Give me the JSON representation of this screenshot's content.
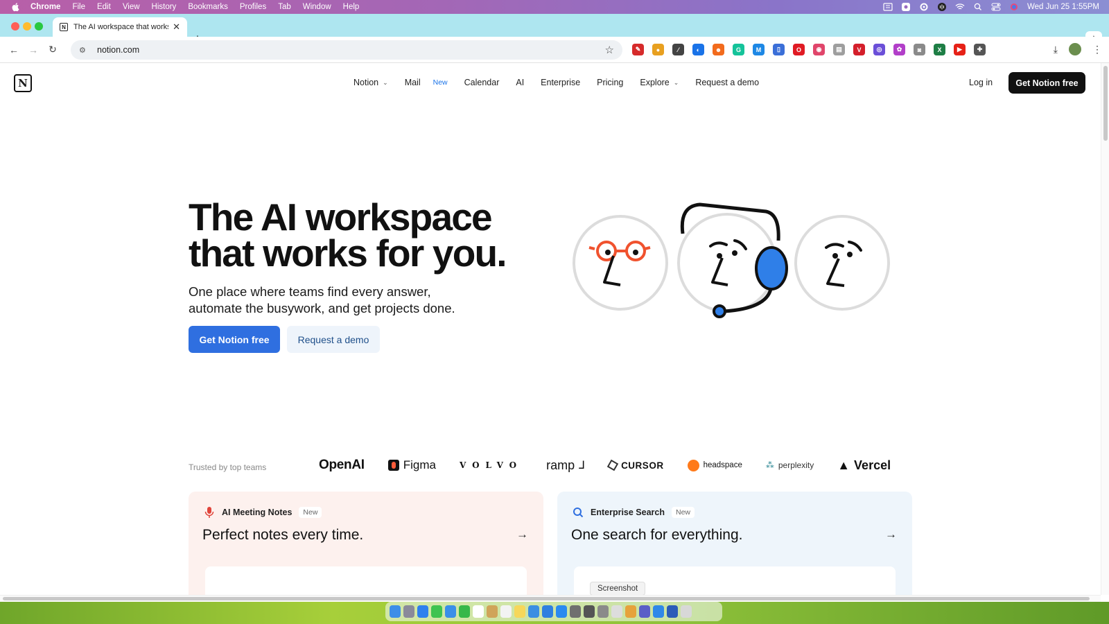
{
  "menubar": {
    "app_name": "Chrome",
    "items": [
      "File",
      "Edit",
      "View",
      "History",
      "Bookmarks",
      "Profiles",
      "Tab",
      "Window",
      "Help"
    ],
    "clock": "Wed Jun 25  1:55PM",
    "status_icons": [
      "mirroring-icon",
      "screen-record-icon",
      "settings-icon",
      "audio-icon",
      "wifi-icon",
      "search-icon",
      "control-center-icon",
      "siri-icon"
    ]
  },
  "browser": {
    "tab_title": "The AI workspace that works",
    "url": "notion.com",
    "extensions": [
      {
        "name": "pen-extension-icon",
        "color": "#d62b2b",
        "glyph": "✎"
      },
      {
        "name": "color-extension-icon",
        "color": "#e8a020",
        "glyph": "●"
      },
      {
        "name": "eyedropper-extension-icon",
        "color": "#444444",
        "glyph": "⁄"
      },
      {
        "name": "blue-extension-icon",
        "color": "#1a73e8",
        "glyph": "◐"
      },
      {
        "name": "orange-extension-icon",
        "color": "#f26b1d",
        "glyph": "☻"
      },
      {
        "name": "grammarly-extension-icon",
        "color": "#15c39a",
        "glyph": "G"
      },
      {
        "name": "m-extension-icon",
        "color": "#1e88e5",
        "glyph": "M"
      },
      {
        "name": "doc-extension-icon",
        "color": "#3b6fd8",
        "glyph": "▯"
      },
      {
        "name": "opera-extension-icon",
        "color": "#e01b24",
        "glyph": "O"
      },
      {
        "name": "pink-extension-icon",
        "color": "#e0466b",
        "glyph": "◉"
      },
      {
        "name": "reader-extension-icon",
        "color": "#9e9e9e",
        "glyph": "▤"
      },
      {
        "name": "vivaldi-extension-icon",
        "color": "#d41f2b",
        "glyph": "V"
      },
      {
        "name": "purple-extension-icon",
        "color": "#6b4fd8",
        "glyph": "◎"
      },
      {
        "name": "flower-extension-icon",
        "color": "#b23fc9",
        "glyph": "✿"
      },
      {
        "name": "camera-extension-icon",
        "color": "#8a8a8a",
        "glyph": "◙"
      },
      {
        "name": "excel-extension-icon",
        "color": "#1e7e45",
        "glyph": "X"
      },
      {
        "name": "youtube-extension-icon",
        "color": "#e62117",
        "glyph": "▶"
      },
      {
        "name": "puzzle-extension-icon",
        "color": "#555555",
        "glyph": "✚"
      }
    ]
  },
  "site": {
    "nav": [
      {
        "label": "Notion",
        "has_chevron": true
      },
      {
        "label": "Mail",
        "badge": "New"
      },
      {
        "label": "Calendar"
      },
      {
        "label": "AI"
      },
      {
        "label": "Enterprise"
      },
      {
        "label": "Pricing"
      },
      {
        "label": "Explore",
        "has_chevron": true
      },
      {
        "label": "Request a demo"
      }
    ],
    "login": "Log in",
    "header_cta": "Get Notion free",
    "hero": {
      "title_line1": "The AI workspace",
      "title_line2": "that works for you.",
      "subtitle_line1": "One place where teams find every answer,",
      "subtitle_line2": "automate the busywork, and get projects done.",
      "primary_cta": "Get Notion free",
      "secondary_cta": "Request a demo"
    },
    "trusted_label": "Trusted by top teams",
    "logos": [
      "OpenAI",
      "Figma",
      "VOLVO",
      "ramp",
      "CURSOR",
      "headspace",
      "perplexity",
      "Vercel"
    ],
    "cards": [
      {
        "tag": "AI Meeting Notes",
        "badge": "New",
        "title": "Perfect notes every time.",
        "accent": "#fdf1ee"
      },
      {
        "tag": "Enterprise Search",
        "badge": "New",
        "title": "One search for everything.",
        "accent": "#eef5fb"
      }
    ],
    "tooltip": "Screenshot"
  },
  "dock": {
    "apps": [
      {
        "name": "finder-icon",
        "color": "#3d8ee8"
      },
      {
        "name": "launchpad-icon",
        "color": "#8a8a9a"
      },
      {
        "name": "safari-icon",
        "color": "#2f80ed"
      },
      {
        "name": "messages-icon",
        "color": "#3fc350"
      },
      {
        "name": "mail-icon",
        "color": "#3a8fe8"
      },
      {
        "name": "facetime-icon",
        "color": "#38b84a"
      },
      {
        "name": "calendar-icon",
        "color": "#ffffff"
      },
      {
        "name": "notes-icon",
        "color": "#d0a45a"
      },
      {
        "name": "reminders-icon",
        "color": "#f3f3f3"
      },
      {
        "name": "stickies-icon",
        "color": "#f6d75a"
      },
      {
        "name": "photos-icon",
        "color": "#3b8ee2"
      },
      {
        "name": "keynote-icon",
        "color": "#2f7fe0"
      },
      {
        "name": "app-store-icon",
        "color": "#2b8af0"
      },
      {
        "name": "settings-icon",
        "color": "#6f6f6f"
      },
      {
        "name": "phone-icon",
        "color": "#555555"
      },
      {
        "name": "screenshot-icon",
        "color": "#8a8a8a"
      },
      {
        "name": "script-editor-icon",
        "color": "#dddddd"
      },
      {
        "name": "chrome-icon",
        "color": "#e6a23c"
      },
      {
        "name": "teams-icon",
        "color": "#5b5fc7"
      },
      {
        "name": "xcode-icon",
        "color": "#2f88e8"
      },
      {
        "name": "word-icon",
        "color": "#2b5cb8"
      },
      {
        "name": "trash-icon",
        "color": "#d8d8d8"
      }
    ]
  }
}
